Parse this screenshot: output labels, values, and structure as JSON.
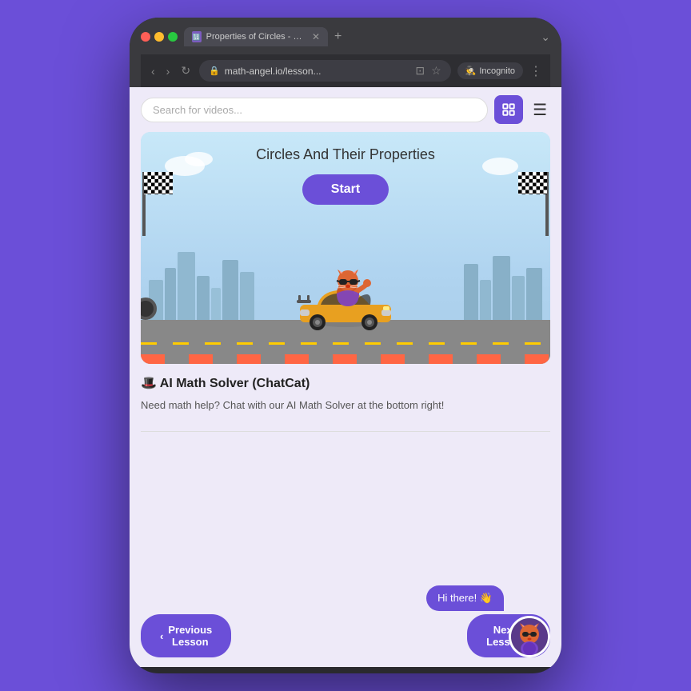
{
  "browser": {
    "tab_label": "Properties of Circles - Diame...",
    "url": "math-angel.io/lesson...",
    "incognito_label": "Incognito"
  },
  "search": {
    "placeholder": "Search for videos..."
  },
  "hero": {
    "title": "Circles And Their Properties",
    "start_button": "Start"
  },
  "ai_section": {
    "title": "🎩 AI Math Solver (ChatCat)",
    "description": "Need math help? Chat with our AI Math Solver at the bottom right!"
  },
  "chat": {
    "bubble_text": "Hi there! 👋"
  },
  "navigation": {
    "prev_label": "Previous\nLesson",
    "next_label": "Next\nLesson"
  }
}
